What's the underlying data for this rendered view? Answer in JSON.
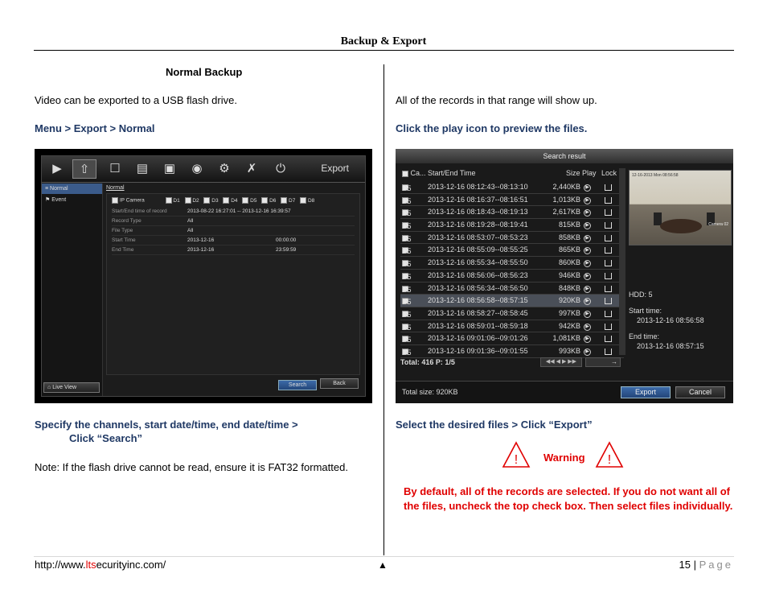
{
  "header": {
    "title": "Backup & Export"
  },
  "left": {
    "heading": "Normal Backup",
    "intro": "Video can be exported to a USB flash drive.",
    "path": "Menu > Export > Normal",
    "step1": "Specify the channels, start date/time, end date/time >",
    "step2": "Click “Search”",
    "note": "Note: If the flash drive cannot be read, ensure it is FAT32 formatted."
  },
  "right": {
    "intro": "All of the records in that range will show up.",
    "instruction": "Click the play icon to preview the files.",
    "select": "Select the desired files > Click “Export”",
    "warning_label": "Warning",
    "warning_text_1": "By default, all of the records are selected.  If you do not want all of",
    "warning_text_2": "the files, uncheck the top check box.  Then select files individually."
  },
  "dvr": {
    "export_title": "Export",
    "side_items": [
      "Normal",
      "Event"
    ],
    "live_view": "Live View",
    "tab": "Normal",
    "camera_label": "IP Camera",
    "channels": [
      "D1",
      "D2",
      "D3",
      "D4",
      "D5",
      "D6",
      "D7",
      "D8"
    ],
    "rows": [
      {
        "label": "Start/End time of record",
        "value": "2013-08-22 16:27:01 -- 2013-12-16 16:39:57",
        "value2": ""
      },
      {
        "label": "Record Type",
        "value": "All",
        "value2": ""
      },
      {
        "label": "File Type",
        "value": "All",
        "value2": ""
      },
      {
        "label": "Start Time",
        "value": "2013-12-16",
        "value2": "00:00:00"
      },
      {
        "label": "End Time",
        "value": "2013-12-16",
        "value2": "23:59:59"
      }
    ],
    "search_btn": "Search",
    "back_btn": "Back"
  },
  "search_result": {
    "title": "Search result",
    "headers": {
      "cam": "Ca...",
      "time": "Start/End Time",
      "size": "Size",
      "play": "Play",
      "lock": "Lock"
    },
    "rows": [
      {
        "cam": "D5",
        "time": "2013-12-16 08:12:43--08:13:10",
        "size": "2,440KB"
      },
      {
        "cam": "D5",
        "time": "2013-12-16 08:16:37--08:16:51",
        "size": "1,013KB"
      },
      {
        "cam": "D5",
        "time": "2013-12-16 08:18:43--08:19:13",
        "size": "2,617KB"
      },
      {
        "cam": "D5",
        "time": "2013-12-16 08:19:28--08:19:41",
        "size": "815KB"
      },
      {
        "cam": "D5",
        "time": "2013-12-16 08:53:07--08:53:23",
        "size": "858KB"
      },
      {
        "cam": "D5",
        "time": "2013-12-16 08:55:09--08:55:25",
        "size": "865KB"
      },
      {
        "cam": "D5",
        "time": "2013-12-16 08:55:34--08:55:50",
        "size": "860KB"
      },
      {
        "cam": "D5",
        "time": "2013-12-16 08:56:06--08:56:23",
        "size": "946KB"
      },
      {
        "cam": "D5",
        "time": "2013-12-16 08:56:34--08:56:50",
        "size": "848KB"
      },
      {
        "cam": "D5",
        "time": "2013-12-16 08:56:58--08:57:15",
        "size": "920KB"
      },
      {
        "cam": "D5",
        "time": "2013-12-16 08:58:27--08:58:45",
        "size": "997KB"
      },
      {
        "cam": "D5",
        "time": "2013-12-16 08:59:01--08:59:18",
        "size": "942KB"
      },
      {
        "cam": "D5",
        "time": "2013-12-16 09:01:06--09:01:26",
        "size": "1,081KB"
      },
      {
        "cam": "D5",
        "time": "2013-12-16 09:01:36--09:01:55",
        "size": "993KB"
      }
    ],
    "highlighted_index": 9,
    "total": "Total: 416  P: 1/5",
    "preview_timestamp": "12-16-2013 Mon 08:56:58",
    "preview_camera": "Camera 02",
    "hdd": "HDD: 5",
    "start_label": "Start time:",
    "start_value": "2013-12-16 08:56:58",
    "end_label": "End time:",
    "end_value": "2013-12-16 08:57:15",
    "total_size": "Total size: 920KB",
    "export_btn": "Export",
    "cancel_btn": "Cancel"
  },
  "footer": {
    "url_prefix": "http://www.",
    "url_brand": "lts",
    "url_suffix": "ecurityinc.com/",
    "page_number": "15",
    "page_sep": " | ",
    "page_word": "Page"
  },
  "colors": {
    "link_blue": "#1f3864",
    "warning_red": "#e00000"
  }
}
